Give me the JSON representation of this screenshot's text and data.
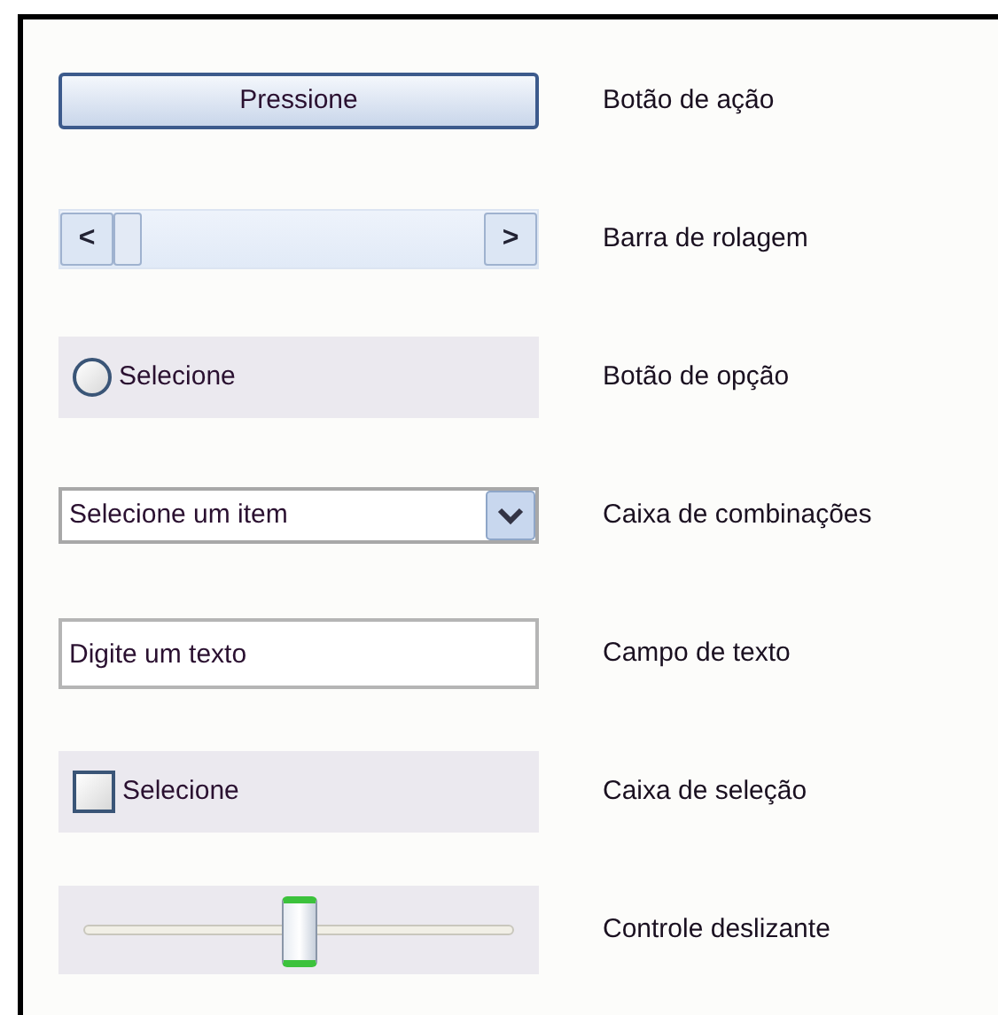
{
  "rows": [
    {
      "kind": "button",
      "control_text": "Pressione",
      "label": "Botão de ação"
    },
    {
      "kind": "scrollbar",
      "left_arrow": "<",
      "right_arrow": ">",
      "label": "Barra de rolagem"
    },
    {
      "kind": "radio",
      "control_text": "Selecione",
      "selected": false,
      "label": "Botão de opção"
    },
    {
      "kind": "combo",
      "value": "Selecione um item",
      "label": "Caixa de combinações"
    },
    {
      "kind": "textfield",
      "value": "Digite um texto",
      "label": "Campo de texto"
    },
    {
      "kind": "checkbox",
      "control_text": "Selecione",
      "checked": false,
      "label": "Caixa de seleção"
    },
    {
      "kind": "slider",
      "level": 0.5,
      "label": "Controle deslizante"
    }
  ]
}
